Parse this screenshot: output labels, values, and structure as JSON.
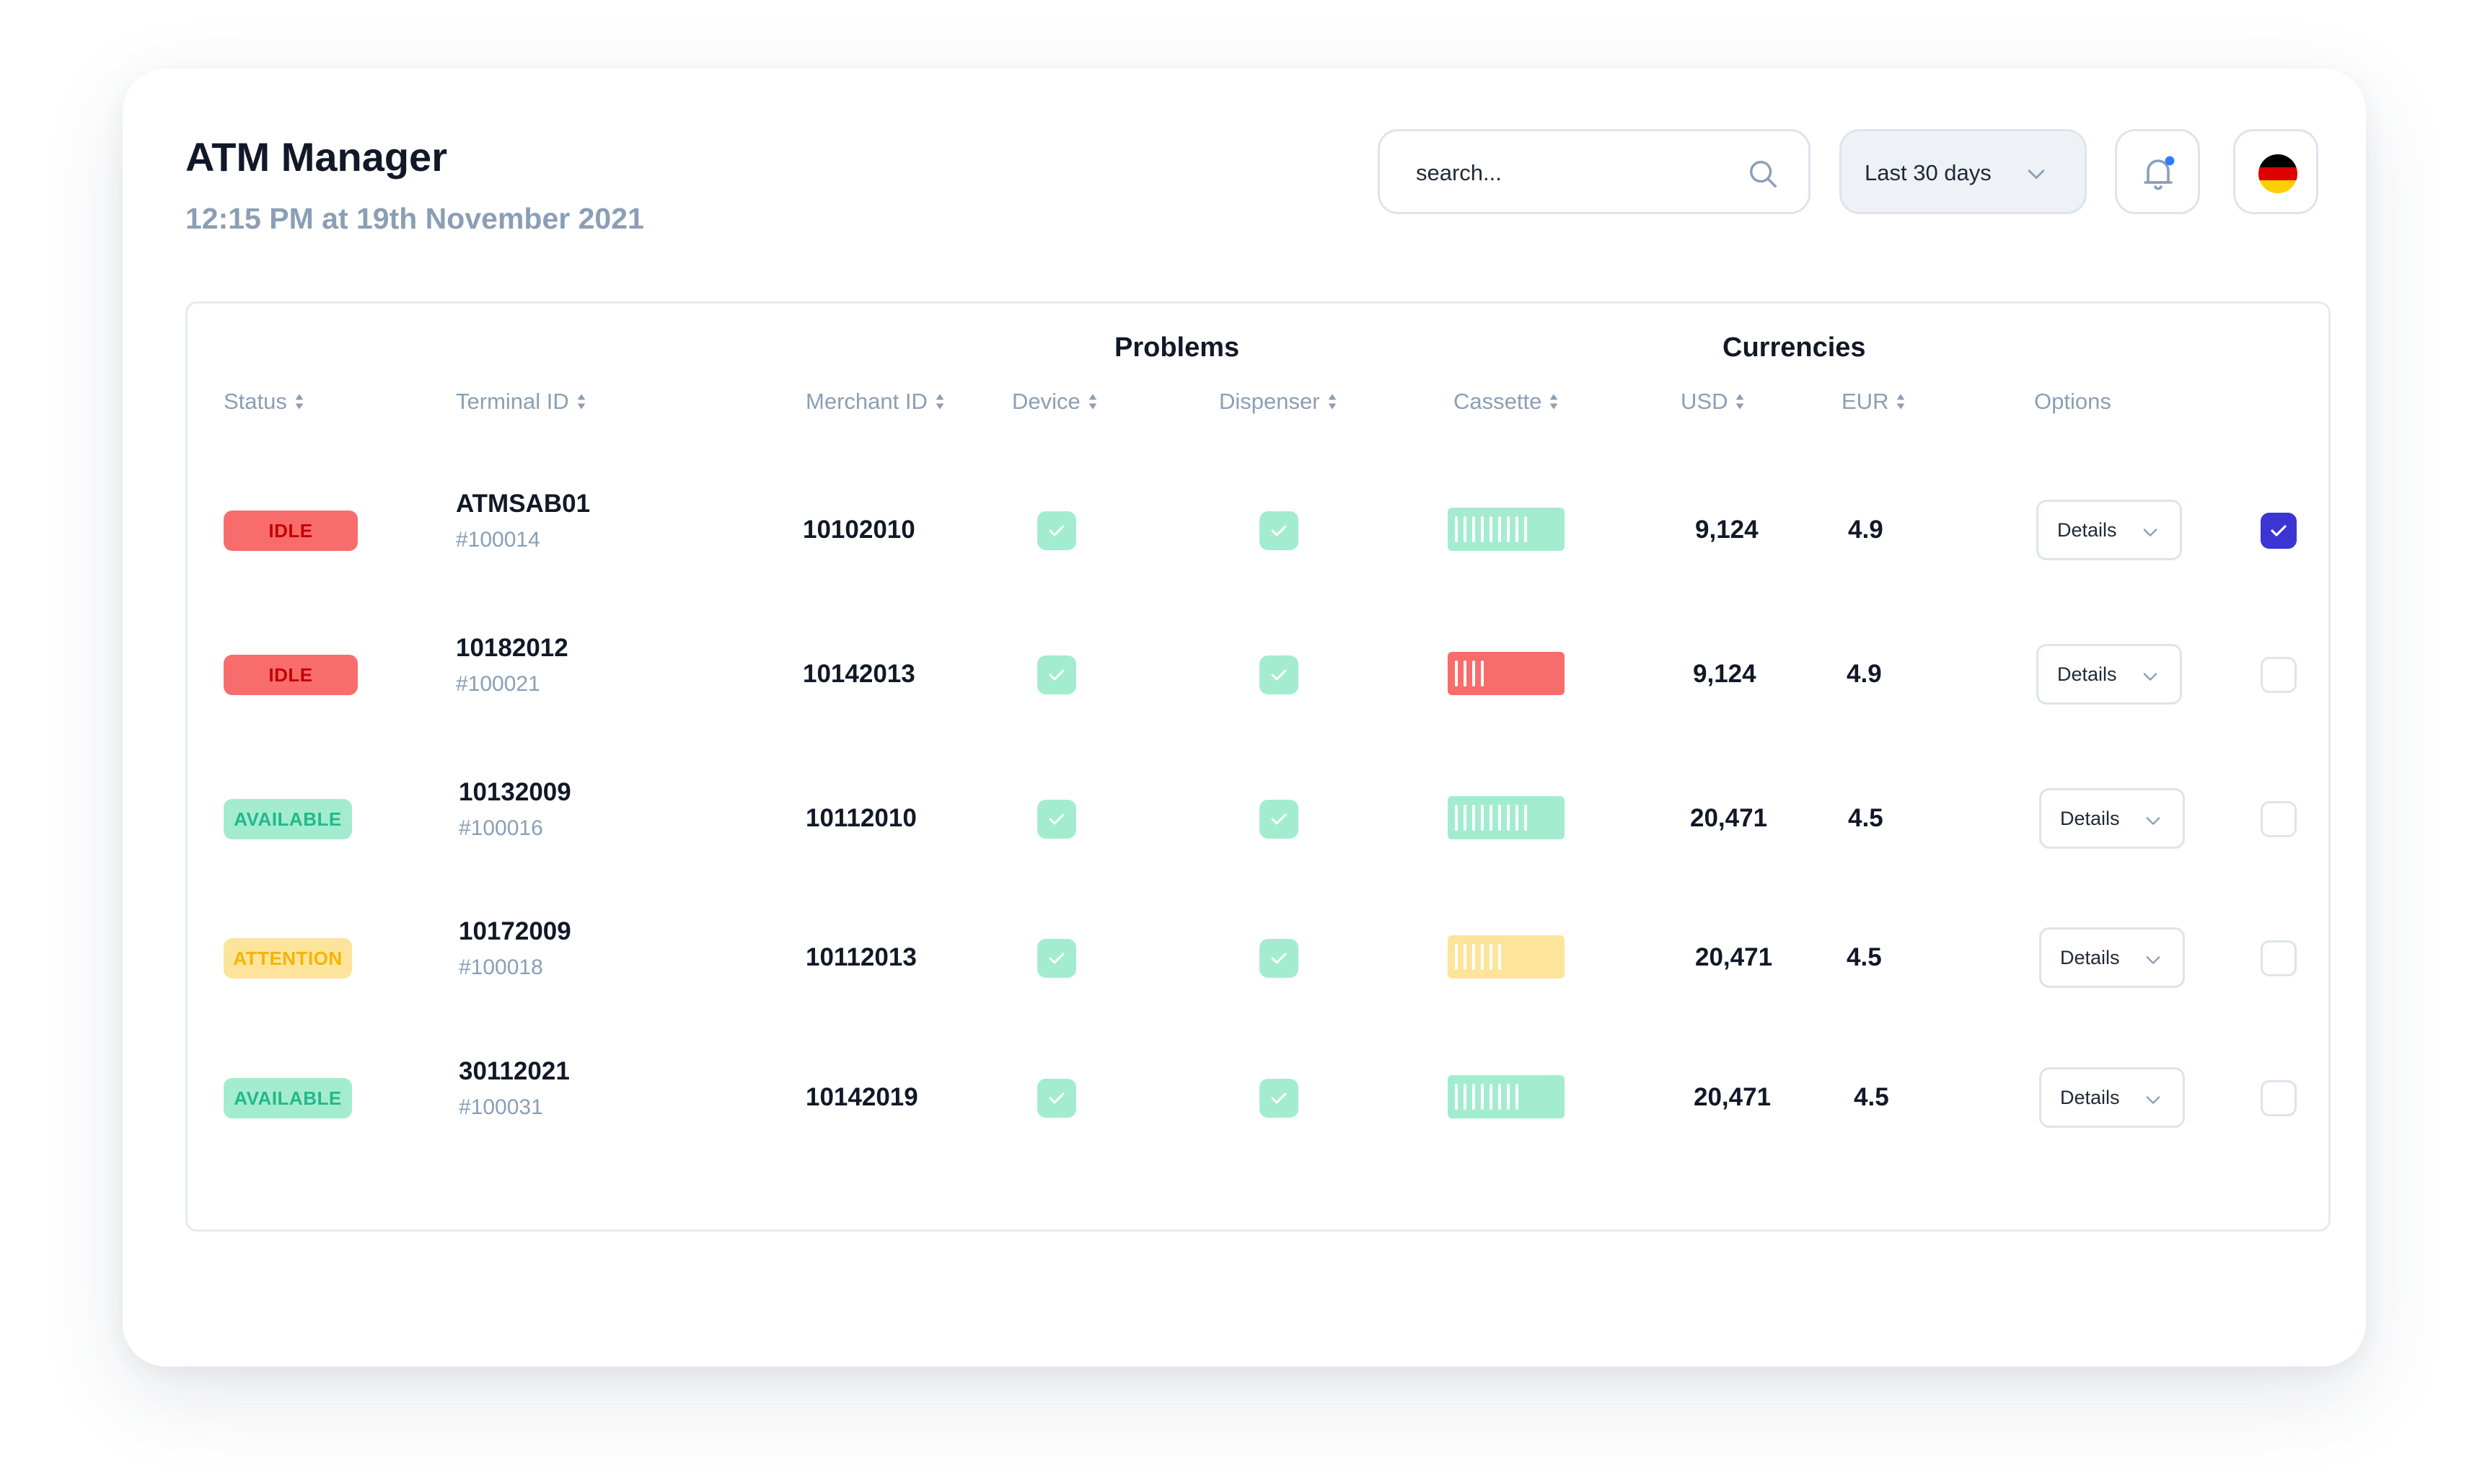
{
  "header": {
    "title": "ATM Manager",
    "subtitle": "12:15 PM at 19th November 2021"
  },
  "search": {
    "placeholder": "search..."
  },
  "date_filter": {
    "label": "Last 30 days"
  },
  "notification": {
    "has_unread": true,
    "dot_color": "#2b7fff"
  },
  "language": {
    "flag": "germany",
    "colors": [
      "#000000",
      "#dd0000",
      "#ffce00"
    ]
  },
  "table": {
    "group_headers": {
      "problems": "Problems",
      "currencies": "Currencies"
    },
    "columns": {
      "status": "Status",
      "terminal_id": "Terminal ID",
      "merchant_id": "Merchant ID",
      "device": "Device",
      "dispenser": "Dispenser",
      "cassette": "Cassette",
      "usd": "USD",
      "eur": "EUR",
      "options": "Options"
    },
    "details_label": "Details",
    "rows": [
      {
        "status": "IDLE",
        "status_type": "idle",
        "terminal_id": "ATMSAB01",
        "terminal_sub": "#100014",
        "merchant_id": "10102010",
        "device_ok": true,
        "dispenser_ok": true,
        "cassette_level": 9,
        "cassette_color": "green",
        "usd": "9,124",
        "eur": "4.9",
        "selected": true
      },
      {
        "status": "IDLE",
        "status_type": "idle",
        "terminal_id": "10182012",
        "terminal_sub": "#100021",
        "merchant_id": "10142013",
        "device_ok": true,
        "dispenser_ok": true,
        "cassette_level": 4,
        "cassette_color": "red",
        "usd": "9,124",
        "eur": "4.9",
        "selected": false
      },
      {
        "status": "AVAILABLE",
        "status_type": "available",
        "terminal_id": "10132009",
        "terminal_sub": "#100016",
        "merchant_id": "10112010",
        "device_ok": true,
        "dispenser_ok": true,
        "cassette_level": 9,
        "cassette_color": "green",
        "usd": "20,471",
        "eur": "4.5",
        "selected": false
      },
      {
        "status": "ATTENTION",
        "status_type": "attention",
        "terminal_id": "10172009",
        "terminal_sub": "#100018",
        "merchant_id": "10112013",
        "device_ok": true,
        "dispenser_ok": true,
        "cassette_level": 6,
        "cassette_color": "yellow",
        "usd": "20,471",
        "eur": "4.5",
        "selected": false
      },
      {
        "status": "AVAILABLE",
        "status_type": "available",
        "terminal_id": "30112021",
        "terminal_sub": "#100031",
        "merchant_id": "10142019",
        "device_ok": true,
        "dispenser_ok": true,
        "cassette_level": 8,
        "cassette_color": "green",
        "usd": "20,471",
        "eur": "4.5",
        "selected": false
      }
    ]
  }
}
